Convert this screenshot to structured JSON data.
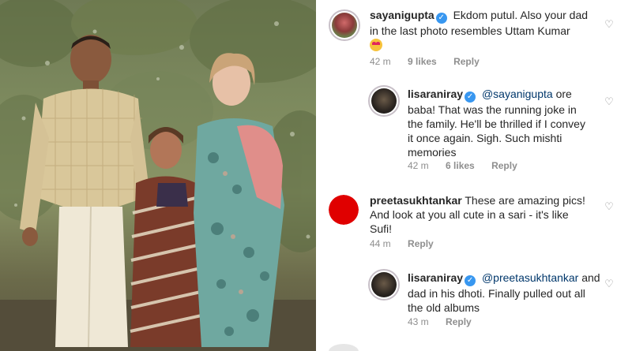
{
  "comments": [
    {
      "username": "sayanigupta",
      "text": "Ekdom putul. Also your dad in the last photo resembles Uttam Kumar",
      "line1": "Ekdom putul. Also your dad",
      "line2": "in the last photo resembles Uttam Kumar",
      "time": "42 m",
      "likes": "9 likes",
      "reply": "Reply"
    },
    {
      "username": "lisaraniray",
      "mention": "@sayanigupta",
      "line1": "ore",
      "line2": "baba! That was the running joke in",
      "line3": "the family. He'll be thrilled if I convey",
      "line4": "it once again. Sigh. Such mishti",
      "line5": "memories",
      "time": "42 m",
      "likes": "6 likes",
      "reply": "Reply"
    },
    {
      "username": "preetasukhtankar",
      "line1": "These are amazing pics!",
      "line2": "And look at you all cute in a sari - it's like",
      "line3": "Sufi!",
      "time": "44 m",
      "reply": "Reply"
    },
    {
      "username": "lisaraniray",
      "mention": "@preetasukhtankar",
      "line1": "and",
      "line2": "dad in his dhoti. Finally pulled out all",
      "line3": "the old albums",
      "time": "43 m",
      "reply": "Reply"
    }
  ],
  "icons": {
    "verified": "verified-badge-icon",
    "heart": "heart-outline-icon"
  },
  "colors": {
    "mention": "#00376b",
    "verified": "#3897f0",
    "meta": "#8e8e8e",
    "avatar_red": "#e00000"
  }
}
